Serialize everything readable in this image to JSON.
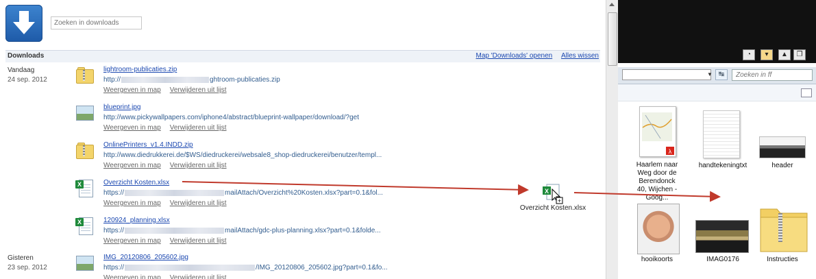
{
  "downloads": {
    "search_placeholder": "Zoeken in downloads",
    "section_title": "Downloads",
    "open_folder_link": "Map 'Downloads' openen",
    "clear_all_link": "Alles wissen",
    "action_show": "Weergeven in map",
    "action_remove": "Verwijderen uit lijst",
    "groups": [
      {
        "day": "Vandaag",
        "date": "24 sep. 2012"
      },
      {
        "day": "Gisteren",
        "date": "23 sep. 2012"
      }
    ],
    "items": [
      {
        "icon": "zip-icon",
        "name": "lightroom-publicaties.zip",
        "url_prefix": "http://",
        "url_suffix": "ghtroom-publicaties.zip"
      },
      {
        "icon": "image-icon",
        "name": "blueprint.jpg",
        "url_prefix": "http://www.pickywallpapers.com/iphone4/abstract/blueprint-wallpaper/download/?get",
        "url_suffix": ""
      },
      {
        "icon": "zip-icon",
        "name": "OnlinePrinters_v1.4.INDD.zip",
        "url_prefix": "http://www.diedrukkerei.de/$WS/diedruckerei/websale8_shop-diedruckerei/benutzer/templ...",
        "url_suffix": ""
      },
      {
        "icon": "excel-icon",
        "name": "Overzicht Kosten.xlsx",
        "url_prefix": "https://",
        "url_suffix": "mailAttach/Overzicht%20Kosten.xlsx?part=0.1&fol..."
      },
      {
        "icon": "excel-icon",
        "name": "120924_planning.xlsx",
        "url_prefix": "https://",
        "url_suffix": "mailAttach/gdc-plus-planning.xlsx?part=0.1&folde..."
      },
      {
        "icon": "image-icon",
        "name": "IMG_20120806_205602.jpg",
        "url_prefix": "https://",
        "url_suffix": "/IMG_20120806_205602.jpg?part=0.1&fo..."
      }
    ]
  },
  "drag": {
    "label": "Overzicht Kosten.xlsx",
    "arrow_color": "#c0392b"
  },
  "explorer": {
    "search_placeholder": "Zoeken in ff",
    "files": [
      {
        "name": "Haarlem naar Weg door de Berendonck 40, Wijchen - Goog...",
        "thumb": "map-pdf"
      },
      {
        "name": "handtekeningtxt",
        "thumb": "text-doc"
      },
      {
        "name": "header",
        "thumb": "photo"
      },
      {
        "name": "hooikoorts",
        "thumb": "photo"
      },
      {
        "name": "IMAG0176",
        "thumb": "photo"
      },
      {
        "name": "Instructies",
        "thumb": "zip-folder"
      }
    ]
  }
}
